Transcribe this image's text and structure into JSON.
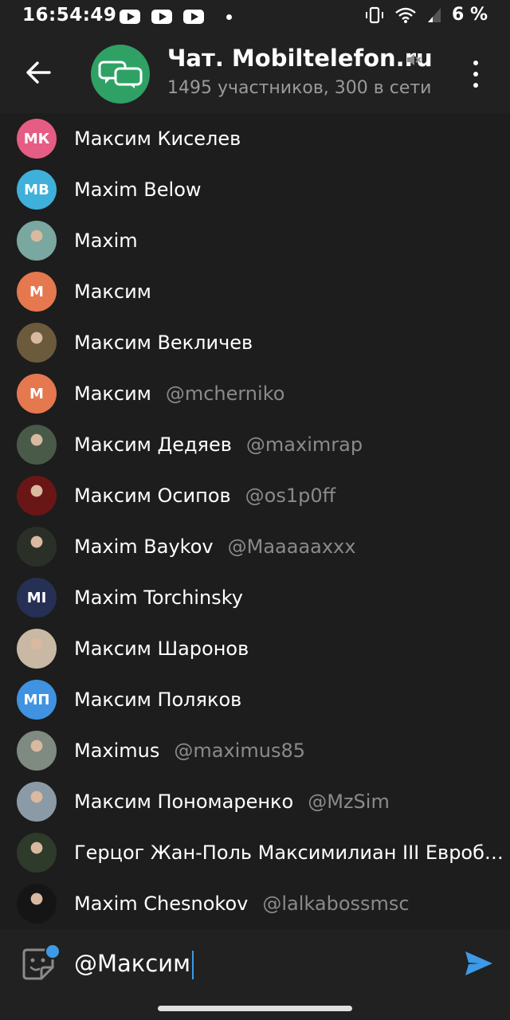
{
  "status_bar": {
    "time": "16:54:49",
    "battery": "6 %",
    "notification_icons": [
      "youtube-icon",
      "youtube-icon",
      "youtube-icon"
    ]
  },
  "header": {
    "title": "Чат. Mobiltelefon.ru",
    "subtitle": "1495 участников, 300 в сети"
  },
  "mentions": [
    {
      "name": "Максим Киселев",
      "username": "",
      "initials": "МК",
      "avatar_color": "#e55c84"
    },
    {
      "name": "Maxim Below",
      "username": "",
      "initials": "MB",
      "avatar_color": "#3fb0d9"
    },
    {
      "name": "Maxim",
      "username": "",
      "initials": "",
      "avatar_color": "#7aa7a0"
    },
    {
      "name": "Максим",
      "username": "",
      "initials": "М",
      "avatar_color": "#e5784e"
    },
    {
      "name": "Максим Векличев",
      "username": "",
      "initials": "",
      "avatar_color": "#6b5a3c"
    },
    {
      "name": "Максим",
      "username": "@mcherniko",
      "initials": "М",
      "avatar_color": "#e5784e"
    },
    {
      "name": "Максим Дедяев",
      "username": "@maximrap",
      "initials": "",
      "avatar_color": "#4a5a48"
    },
    {
      "name": "Максим Осипов",
      "username": "@os1p0ff",
      "initials": "",
      "avatar_color": "#6a1616"
    },
    {
      "name": "Maxim Baykov",
      "username": "@Maaaaaxxx",
      "initials": "",
      "avatar_color": "#2a3028"
    },
    {
      "name": "Maxim Torchinsky",
      "username": "",
      "initials": "MI",
      "avatar_color": "#263055"
    },
    {
      "name": "Максим Шаронов",
      "username": "",
      "initials": "",
      "avatar_color": "#c9b8a4"
    },
    {
      "name": "Максим Поляков",
      "username": "",
      "initials": "МП",
      "avatar_color": "#3f93e0"
    },
    {
      "name": "Maximus",
      "username": "@maximus85",
      "initials": "",
      "avatar_color": "#7f8a80"
    },
    {
      "name": "Максим Пономаренко",
      "username": "@MzSim",
      "initials": "",
      "avatar_color": "#8a9aa6"
    },
    {
      "name": "Герцог Жан-Поль Максимилиан III Евробо…",
      "username": "",
      "initials": "",
      "avatar_color": "#2e3a2a"
    },
    {
      "name": "Maxim Chesnokov",
      "username": "@lalkabossmsc",
      "initials": "",
      "avatar_color": "#151515"
    }
  ],
  "composer": {
    "text": "@Максим"
  },
  "colors": {
    "accent": "#3d9ae6",
    "background": "#212121",
    "list_background": "#1d1d1d",
    "secondary_text": "#8a8a8a"
  }
}
